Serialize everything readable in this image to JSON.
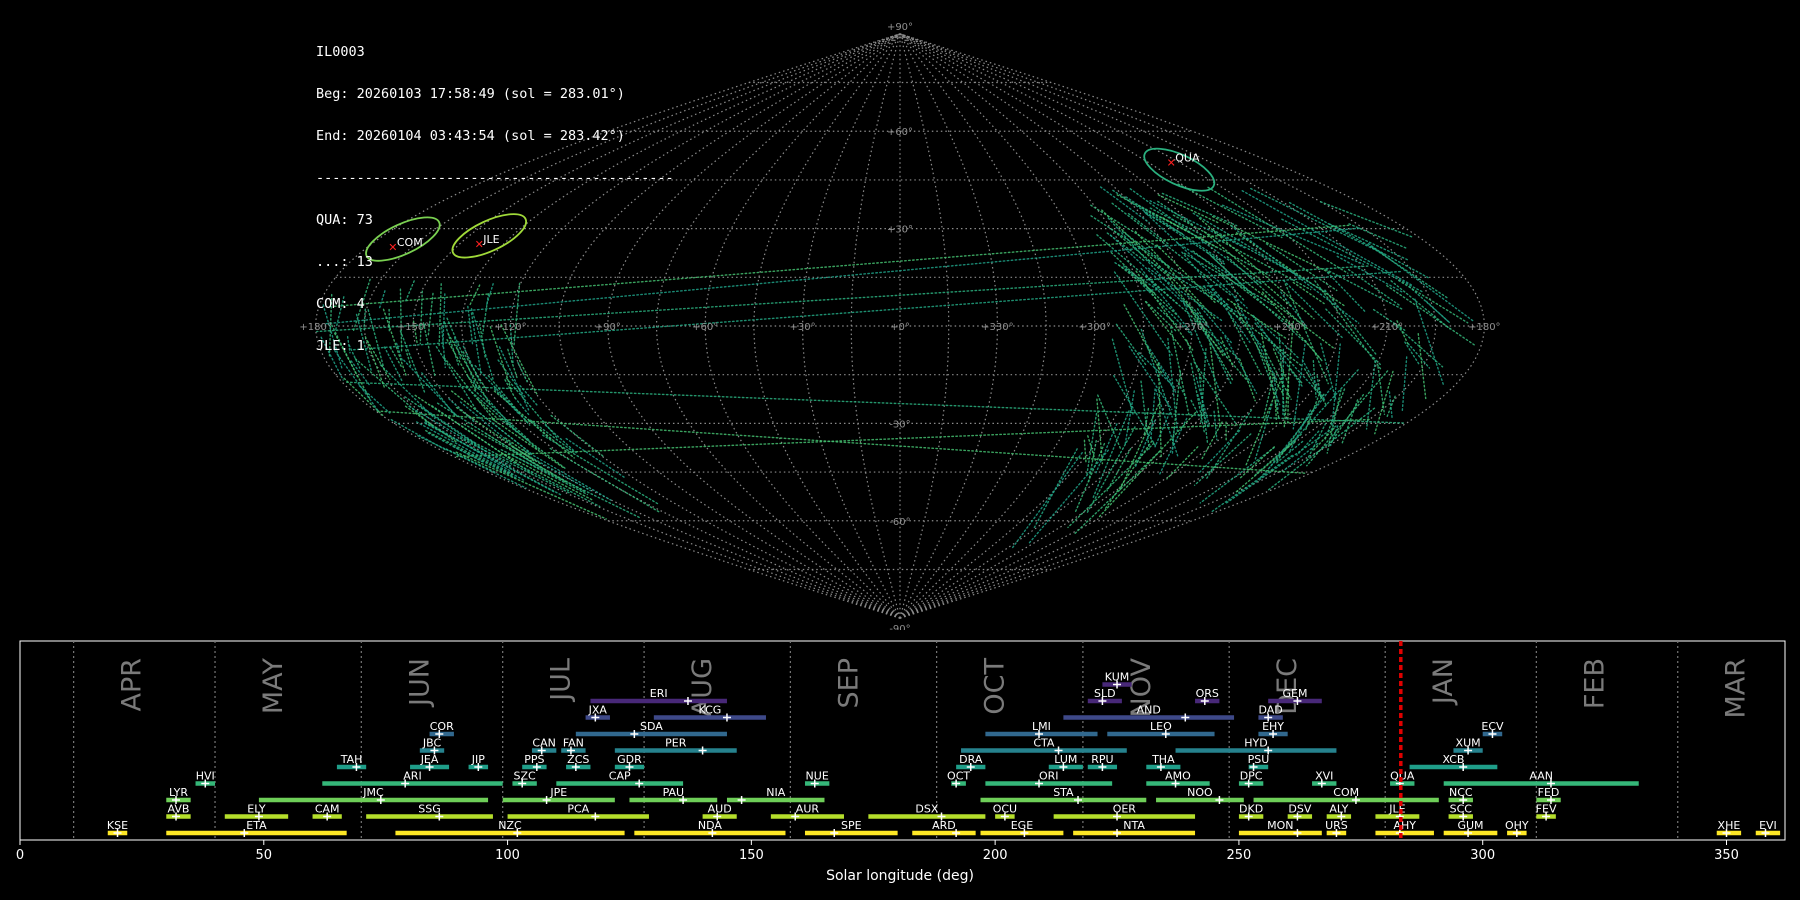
{
  "info": {
    "camera": "IL0003",
    "beg": "Beg: 20260103 17:58:49 (sol = 283.01°)",
    "end": "End: 20260104 03:43:54 (sol = 283.42°)",
    "divider": "--------------------------------------------",
    "counts": [
      "QUA: 73",
      "...: 13",
      "COM: 4",
      "JLE: 1"
    ]
  },
  "sky": {
    "lon_labels": [
      "+180°",
      "+150°",
      "+120°",
      "+90°",
      "+60°",
      "+30°",
      "+0°",
      "+330°",
      "+300°",
      "+270°",
      "+240°",
      "+210°",
      "+180°"
    ],
    "lat_labels": [
      {
        "lat": 90,
        "text": "+90°"
      },
      {
        "lat": 60,
        "text": "+60°"
      },
      {
        "lat": 30,
        "text": "+30°"
      },
      {
        "lat": -30,
        "text": "-30°"
      },
      {
        "lat": -60,
        "text": "-60°"
      },
      {
        "lat": -90,
        "text": "-90°"
      }
    ],
    "radiants": [
      {
        "code": "COM",
        "lon": 171,
        "lat": 24,
        "color": "#7ad151"
      },
      {
        "code": "JLE",
        "lon": 143,
        "lat": 25,
        "color": "#a0da39"
      },
      {
        "code": "QUA",
        "lon": 230,
        "lat": 50,
        "color": "#2ab07f"
      }
    ]
  },
  "chart_data": {
    "type": "timeline",
    "xlabel": "Solar longitude (deg)",
    "xlim": [
      0,
      362
    ],
    "xticks": [
      0,
      50,
      100,
      150,
      200,
      250,
      300,
      350
    ],
    "months": [
      {
        "name": "APR",
        "start": 11
      },
      {
        "name": "MAY",
        "start": 40
      },
      {
        "name": "JUN",
        "start": 70
      },
      {
        "name": "JUL",
        "start": 99
      },
      {
        "name": "AUG",
        "start": 128
      },
      {
        "name": "SEP",
        "start": 158
      },
      {
        "name": "OCT",
        "start": 188
      },
      {
        "name": "NOV",
        "start": 218
      },
      {
        "name": "DEC",
        "start": 248
      },
      {
        "name": "JAN",
        "start": 280
      },
      {
        "name": "FEB",
        "start": 311
      },
      {
        "name": "MAR",
        "start": 340
      }
    ],
    "current_sol": 283.2,
    "showers": [
      {
        "code": "KUM",
        "start": 222,
        "end": 228,
        "peak": 225,
        "row": 8
      },
      {
        "code": "ERI",
        "start": 117,
        "end": 145,
        "peak": 137,
        "row": 7
      },
      {
        "code": "SLD",
        "start": 219,
        "end": 226,
        "peak": 222,
        "row": 7
      },
      {
        "code": "ORS",
        "start": 241,
        "end": 246,
        "peak": 243,
        "row": 7
      },
      {
        "code": "GEM",
        "start": 256,
        "end": 267,
        "peak": 262,
        "row": 7
      },
      {
        "code": "JXA",
        "start": 116,
        "end": 121,
        "peak": 118,
        "row": 6
      },
      {
        "code": "KCG",
        "start": 130,
        "end": 153,
        "peak": 145,
        "row": 6
      },
      {
        "code": "AND",
        "start": 214,
        "end": 249,
        "peak": 239,
        "row": 6
      },
      {
        "code": "DAD",
        "start": 254,
        "end": 259,
        "peak": 256,
        "row": 6
      },
      {
        "code": "COR",
        "start": 84,
        "end": 89,
        "peak": 86,
        "row": 5
      },
      {
        "code": "SDA",
        "start": 114,
        "end": 145,
        "peak": 126,
        "row": 5
      },
      {
        "code": "LMI",
        "start": 198,
        "end": 221,
        "peak": 209,
        "row": 5
      },
      {
        "code": "LEO",
        "start": 223,
        "end": 245,
        "peak": 235,
        "row": 5
      },
      {
        "code": "EHY",
        "start": 254,
        "end": 260,
        "peak": 257,
        "row": 5
      },
      {
        "code": "ECV",
        "start": 300,
        "end": 304,
        "peak": 302,
        "row": 5
      },
      {
        "code": "JBC",
        "start": 82,
        "end": 87,
        "peak": 85,
        "row": 4
      },
      {
        "code": "CAN",
        "start": 105,
        "end": 110,
        "peak": 107,
        "row": 4
      },
      {
        "code": "FAN",
        "start": 111,
        "end": 116,
        "peak": 113,
        "row": 4
      },
      {
        "code": "PER",
        "start": 122,
        "end": 147,
        "peak": 140,
        "row": 4
      },
      {
        "code": "CTA",
        "start": 193,
        "end": 227,
        "peak": 213,
        "row": 4
      },
      {
        "code": "HYD",
        "start": 237,
        "end": 270,
        "peak": 256,
        "row": 4
      },
      {
        "code": "XUM",
        "start": 294,
        "end": 300,
        "peak": 297,
        "row": 4
      },
      {
        "code": "TAH",
        "start": 65,
        "end": 71,
        "peak": 69,
        "row": 3
      },
      {
        "code": "JEA",
        "start": 80,
        "end": 88,
        "peak": 84,
        "row": 3
      },
      {
        "code": "JIP",
        "start": 92,
        "end": 96,
        "peak": 94,
        "row": 3
      },
      {
        "code": "PPS",
        "start": 103,
        "end": 108,
        "peak": 106,
        "row": 3
      },
      {
        "code": "ZCS",
        "start": 112,
        "end": 117,
        "peak": 114,
        "row": 3
      },
      {
        "code": "GDR",
        "start": 122,
        "end": 128,
        "peak": 125,
        "row": 3
      },
      {
        "code": "DRA",
        "start": 192,
        "end": 198,
        "peak": 195,
        "row": 3
      },
      {
        "code": "LUM",
        "start": 211,
        "end": 218,
        "peak": 214,
        "row": 3
      },
      {
        "code": "RPU",
        "start": 219,
        "end": 225,
        "peak": 222,
        "row": 3
      },
      {
        "code": "THA",
        "start": 231,
        "end": 238,
        "peak": 234,
        "row": 3
      },
      {
        "code": "PSU",
        "start": 252,
        "end": 256,
        "peak": 253,
        "row": 3
      },
      {
        "code": "XCB",
        "start": 285,
        "end": 303,
        "peak": 296,
        "row": 3
      },
      {
        "code": "HVI",
        "start": 36,
        "end": 40,
        "peak": 38,
        "row": 2
      },
      {
        "code": "ARI",
        "start": 62,
        "end": 99,
        "peak": 79,
        "row": 2
      },
      {
        "code": "SZC",
        "start": 101,
        "end": 106,
        "peak": 103,
        "row": 2
      },
      {
        "code": "CAP",
        "start": 110,
        "end": 136,
        "peak": 127,
        "row": 2
      },
      {
        "code": "NUE",
        "start": 161,
        "end": 166,
        "peak": 163,
        "row": 2
      },
      {
        "code": "OCT",
        "start": 191,
        "end": 194,
        "peak": 192,
        "row": 2
      },
      {
        "code": "ORI",
        "start": 198,
        "end": 224,
        "peak": 209,
        "row": 2
      },
      {
        "code": "AMO",
        "start": 231,
        "end": 244,
        "peak": 237,
        "row": 2
      },
      {
        "code": "DPC",
        "start": 250,
        "end": 255,
        "peak": 252,
        "row": 2
      },
      {
        "code": "XVI",
        "start": 265,
        "end": 270,
        "peak": 267,
        "row": 2
      },
      {
        "code": "QUA",
        "start": 281,
        "end": 286,
        "peak": 283,
        "row": 2
      },
      {
        "code": "AAN",
        "start": 292,
        "end": 332,
        "peak": 314,
        "row": 2
      },
      {
        "code": "LYR",
        "start": 30,
        "end": 35,
        "peak": 32,
        "row": 1
      },
      {
        "code": "JMC",
        "start": 49,
        "end": 96,
        "peak": 74,
        "row": 1
      },
      {
        "code": "JPE",
        "start": 99,
        "end": 122,
        "peak": 108,
        "row": 1
      },
      {
        "code": "PAU",
        "start": 125,
        "end": 143,
        "peak": 136,
        "row": 1
      },
      {
        "code": "NIA",
        "start": 145,
        "end": 165,
        "peak": 148,
        "row": 1
      },
      {
        "code": "STA",
        "start": 197,
        "end": 231,
        "peak": 217,
        "row": 1
      },
      {
        "code": "NOO",
        "start": 233,
        "end": 251,
        "peak": 246,
        "row": 1
      },
      {
        "code": "COM",
        "start": 253,
        "end": 291,
        "peak": 274,
        "row": 1
      },
      {
        "code": "NCC",
        "start": 293,
        "end": 298,
        "peak": 296,
        "row": 1
      },
      {
        "code": "FED",
        "start": 311,
        "end": 316,
        "peak": 314,
        "row": 1
      },
      {
        "code": "AVB",
        "start": 30,
        "end": 35,
        "peak": 32,
        "row": 0
      },
      {
        "code": "ELY",
        "start": 42,
        "end": 55,
        "peak": 49,
        "row": 0
      },
      {
        "code": "CAM",
        "start": 60,
        "end": 66,
        "peak": 63,
        "row": 0
      },
      {
        "code": "SSG",
        "start": 71,
        "end": 97,
        "peak": 86,
        "row": 0
      },
      {
        "code": "PCA",
        "start": 100,
        "end": 129,
        "peak": 118,
        "row": 0
      },
      {
        "code": "AUD",
        "start": 140,
        "end": 147,
        "peak": 143,
        "row": 0
      },
      {
        "code": "AUR",
        "start": 154,
        "end": 169,
        "peak": 159,
        "row": 0
      },
      {
        "code": "DSX",
        "start": 174,
        "end": 198,
        "peak": 189,
        "row": 0
      },
      {
        "code": "OCU",
        "start": 200,
        "end": 204,
        "peak": 202,
        "row": 0
      },
      {
        "code": "OER",
        "start": 212,
        "end": 241,
        "peak": 225,
        "row": 0
      },
      {
        "code": "DKD",
        "start": 250,
        "end": 255,
        "peak": 252,
        "row": 0
      },
      {
        "code": "DSV",
        "start": 260,
        "end": 265,
        "peak": 262,
        "row": 0
      },
      {
        "code": "ALY",
        "start": 268,
        "end": 273,
        "peak": 271,
        "row": 0
      },
      {
        "code": "JLE",
        "start": 278,
        "end": 287,
        "peak": 283,
        "row": 0
      },
      {
        "code": "SCC",
        "start": 293,
        "end": 298,
        "peak": 296,
        "row": 0
      },
      {
        "code": "FEV",
        "start": 311,
        "end": 315,
        "peak": 313,
        "row": 0
      },
      {
        "code": "KSE",
        "start": 18,
        "end": 22,
        "peak": 20,
        "row": -1
      },
      {
        "code": "ETA",
        "start": 30,
        "end": 67,
        "peak": 46,
        "row": -1
      },
      {
        "code": "NZC",
        "start": 77,
        "end": 124,
        "peak": 102,
        "row": -1
      },
      {
        "code": "NDA",
        "start": 126,
        "end": 157,
        "peak": 142,
        "row": -1
      },
      {
        "code": "SPE",
        "start": 161,
        "end": 180,
        "peak": 167,
        "row": -1
      },
      {
        "code": "ARD",
        "start": 183,
        "end": 196,
        "peak": 192,
        "row": -1
      },
      {
        "code": "EGE",
        "start": 197,
        "end": 214,
        "peak": 206,
        "row": -1
      },
      {
        "code": "NTA",
        "start": 216,
        "end": 241,
        "peak": 225,
        "row": -1
      },
      {
        "code": "MON",
        "start": 250,
        "end": 267,
        "peak": 262,
        "row": -1
      },
      {
        "code": "URS",
        "start": 268,
        "end": 272,
        "peak": 270,
        "row": -1
      },
      {
        "code": "AHY",
        "start": 278,
        "end": 290,
        "peak": 283,
        "row": -1
      },
      {
        "code": "GUM",
        "start": 292,
        "end": 303,
        "peak": 297,
        "row": -1
      },
      {
        "code": "OHY",
        "start": 305,
        "end": 309,
        "peak": 307,
        "row": -1
      },
      {
        "code": "XHE",
        "start": 348,
        "end": 353,
        "peak": 350,
        "row": -1
      },
      {
        "code": "EVI",
        "start": 356,
        "end": 361,
        "peak": 358,
        "row": -1
      }
    ]
  }
}
